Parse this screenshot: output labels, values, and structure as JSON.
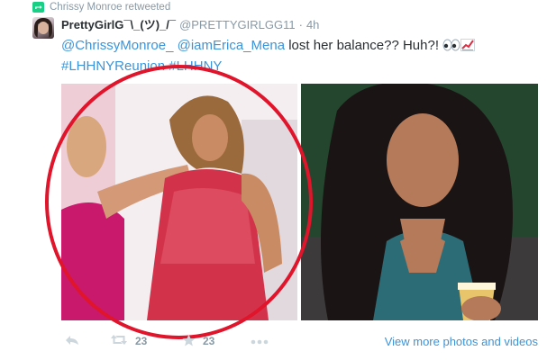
{
  "retweet_context": {
    "icon": "retweet-icon",
    "text": "Chrissy Monroe retweeted"
  },
  "tweet": {
    "avatar": "avatar-image",
    "display_name": "PrettyGirlG¯\\_(ツ)_/¯",
    "screen_name": "@PRETTYGIRLGG11",
    "separator": "·",
    "time": "4h",
    "text": {
      "mention_1": "@ChrissyMonroe_",
      "mention_2": "@iamErica_Mena",
      "body": " lost her balance?? Huh?! ",
      "hashtag_1": "#LHHNYReunion",
      "hashtag_2": "#LHHNY",
      "emojis": [
        "eyes-emoji",
        "chart-increasing-emoji"
      ]
    },
    "media": {
      "photos": [
        "photo-left-reunion",
        "photo-right-rihanna"
      ],
      "annotation": "red-circle"
    },
    "actions": {
      "reply_icon": "reply-icon",
      "retweet_icon": "retweet-icon",
      "retweet_count": "23",
      "favorite_icon": "star-icon",
      "favorite_count": "23",
      "more_icon": "more-dots-icon",
      "view_more_label": "View more photos and videos"
    }
  },
  "colors": {
    "link": "#3b94d9",
    "text": "#292f33",
    "muted": "#8899a6",
    "retweet_green": "#19cf86",
    "annotation_red": "#e0142a"
  }
}
